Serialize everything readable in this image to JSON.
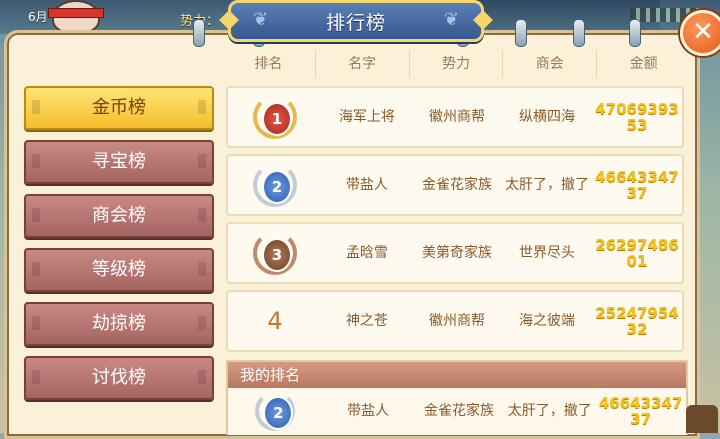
{
  "hud": {
    "month": "6月",
    "faction_label": "势力："
  },
  "title": "排行榜",
  "close_label": "✕",
  "tabs": [
    {
      "label": "金币榜",
      "active": true
    },
    {
      "label": "寻宝榜",
      "active": false
    },
    {
      "label": "商会榜",
      "active": false
    },
    {
      "label": "等级榜",
      "active": false
    },
    {
      "label": "劫掠榜",
      "active": false
    },
    {
      "label": "讨伐榜",
      "active": false
    }
  ],
  "columns": [
    "排名",
    "名字",
    "势力",
    "商会",
    "金额"
  ],
  "rows": [
    {
      "rank": "1",
      "medal": "gold",
      "name": "海军上将",
      "faction": "徽州商帮",
      "guild": "纵横四海",
      "amount": "4706939353"
    },
    {
      "rank": "2",
      "medal": "silver",
      "name": "带盐人",
      "faction": "金雀花家族",
      "guild": "太肝了，撤了",
      "amount": "4664334737"
    },
    {
      "rank": "3",
      "medal": "bronze",
      "name": "孟晗雪",
      "faction": "美第奇家族",
      "guild": "世界尽头",
      "amount": "2629748601"
    },
    {
      "rank": "4",
      "medal": "none",
      "name": "神之苍",
      "faction": "徽州商帮",
      "guild": "海之彼端",
      "amount": "2524795432"
    }
  ],
  "my_rank": {
    "title": "我的排名",
    "rank": "2",
    "name": "带盐人",
    "faction": "金雀花家族",
    "guild": "太肝了，撤了",
    "amount": "4664334737"
  },
  "colors": {
    "panel_bg": "#fbf0d8",
    "tab_active": "#f4be2a",
    "tab_inactive": "#a46562",
    "gold_text": "#f3c21a",
    "title_plaque": "#35588f"
  }
}
